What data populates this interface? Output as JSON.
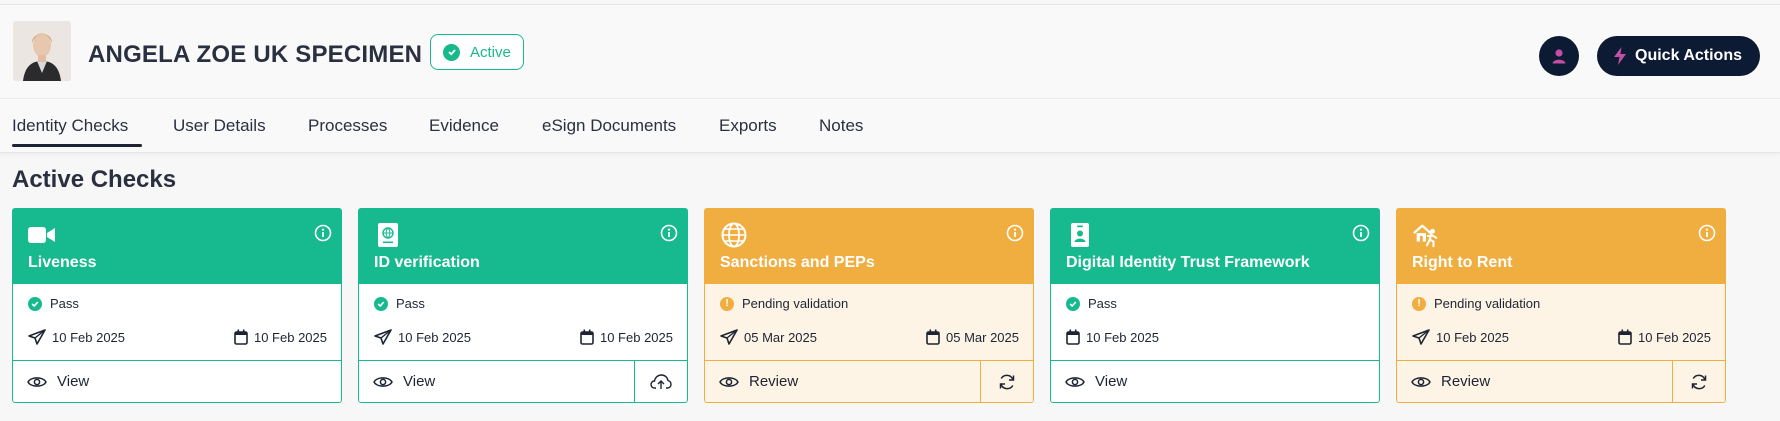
{
  "header": {
    "name": "ANGELA ZOE UK SPECIMEN",
    "status": "Active",
    "quick_actions": "Quick Actions"
  },
  "tabs": [
    {
      "label": "Identity Checks",
      "active": true
    },
    {
      "label": "User Details"
    },
    {
      "label": "Processes"
    },
    {
      "label": "Evidence"
    },
    {
      "label": "eSign Documents"
    },
    {
      "label": "Exports"
    },
    {
      "label": "Notes"
    }
  ],
  "section_title": "Active Checks",
  "colors": {
    "green": "#17b98f",
    "amber": "#efae3f",
    "navy": "#0c1a33"
  },
  "cards": [
    {
      "title": "Liveness",
      "icon": "video-camera-icon",
      "status": "Pass",
      "date_sent": "10 Feb 2025",
      "date_completed": "10 Feb 2025",
      "action": "View"
    },
    {
      "title": "ID verification",
      "icon": "passport-icon",
      "status": "Pass",
      "date_sent": "10 Feb 2025",
      "date_completed": "10 Feb 2025",
      "action": "View",
      "side_icon": "upload-cloud-icon"
    },
    {
      "title": "Sanctions and PEPs",
      "icon": "globe-icon",
      "status": "Pending validation",
      "date_sent": "05 Mar 2025",
      "date_completed": "05 Mar 2025",
      "action": "Review",
      "side_icon": "refresh-icon"
    },
    {
      "title": "Digital Identity Trust Framework",
      "icon": "id-badge-icon",
      "status": "Pass",
      "date_completed": "10 Feb 2025",
      "action": "View"
    },
    {
      "title": "Right to Rent",
      "icon": "house-person-icon",
      "status": "Pending validation",
      "date_sent": "10 Feb 2025",
      "date_completed": "10 Feb 2025",
      "action": "Review",
      "side_icon": "refresh-icon"
    }
  ]
}
